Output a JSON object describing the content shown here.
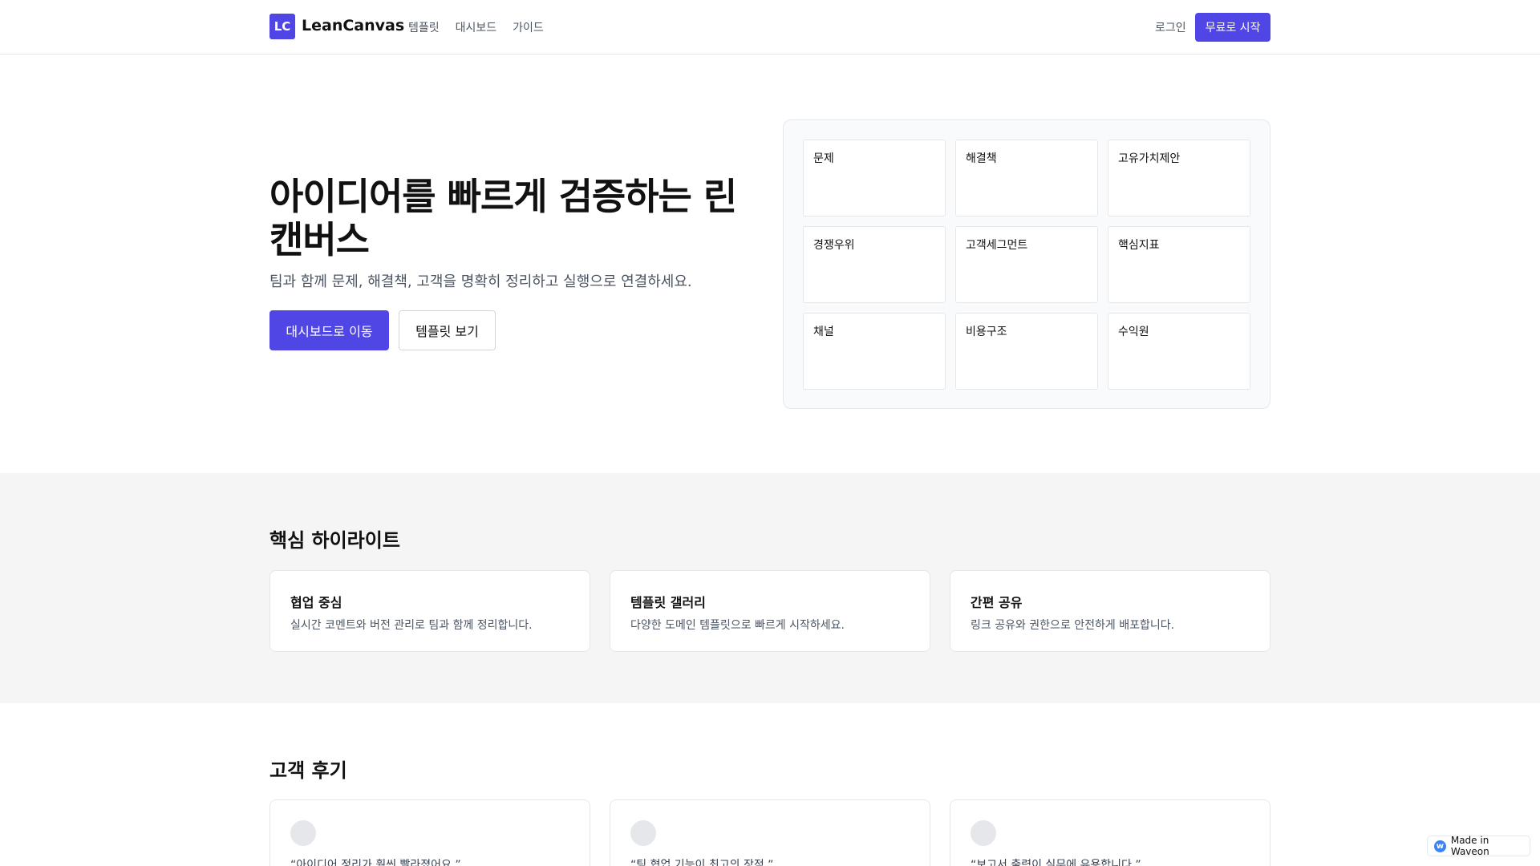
{
  "header": {
    "logo_mark": "LC",
    "logo_text": "LeanCanvas",
    "nav": [
      "템플릿",
      "대시보드",
      "가이드"
    ],
    "login": "로그인",
    "start": "무료로 시작"
  },
  "hero": {
    "title": "아이디어를 빠르게 검증하는 린 캔버스",
    "subtitle": "팀과 함께 문제, 해결책, 고객을 명확히 정리하고 실행으로 연결하세요.",
    "primary_button": "대시보드로 이동",
    "secondary_button": "템플릿 보기"
  },
  "canvas": {
    "cells": [
      "문제",
      "해결책",
      "고유가치제안",
      "경쟁우위",
      "고객세그먼트",
      "핵심지표",
      "채널",
      "비용구조",
      "수익원"
    ]
  },
  "highlights": {
    "title": "핵심 하이라이트",
    "items": [
      {
        "title": "협업 중심",
        "desc": "실시간 코멘트와 버전 관리로 팀과 함께 정리합니다."
      },
      {
        "title": "템플릿 갤러리",
        "desc": "다양한 도메인 템플릿으로 빠르게 시작하세요."
      },
      {
        "title": "간편 공유",
        "desc": "링크 공유와 권한으로 안전하게 배포합니다."
      }
    ]
  },
  "reviews": {
    "title": "고객 후기",
    "items": [
      {
        "quote": "“아이디어 정리가 훨씬 빨라졌어요.”"
      },
      {
        "quote": "“팀 협업 기능이 최고의 장점.”"
      },
      {
        "quote": "“보고서 출력이 실무에 유용합니다.”"
      }
    ]
  },
  "badge": {
    "icon": "waveon-logo-icon",
    "label": "Made in Waveon"
  },
  "colors": {
    "accent": "#4f46e5",
    "section_bg": "#f5f5f5",
    "border": "#e5e7eb"
  }
}
